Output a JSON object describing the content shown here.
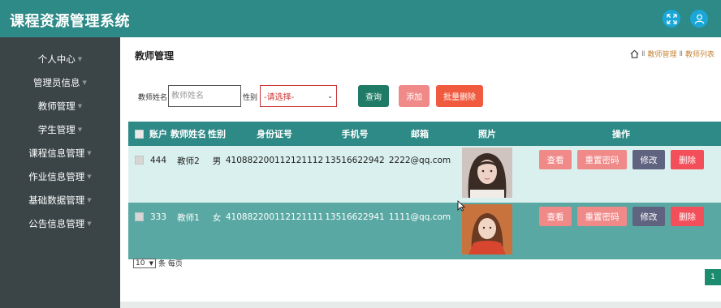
{
  "app": {
    "title": "课程资源管理系统"
  },
  "header": {
    "icons": [
      "fullscreen-icon",
      "user-icon"
    ]
  },
  "sidebar": {
    "items": [
      {
        "label": "个人中心"
      },
      {
        "label": "管理员信息"
      },
      {
        "label": "教师管理"
      },
      {
        "label": "学生管理"
      },
      {
        "label": "课程信息管理"
      },
      {
        "label": "作业信息管理"
      },
      {
        "label": "基础数据管理"
      },
      {
        "label": "公告信息管理"
      }
    ]
  },
  "page": {
    "title": "教师管理",
    "breadcrumb": {
      "sep1": "Ⅱ",
      "level1": "教师管理",
      "sep2": "Ⅱ",
      "level2": "教师列表"
    }
  },
  "search": {
    "name_label": "教师姓名",
    "name_placeholder": "教师姓名",
    "name_value": "",
    "gender_label": "性别",
    "gender_selected": "-请选择-",
    "query_label": "查询",
    "add_label": "添加",
    "batch_delete_label": "批量删除"
  },
  "table": {
    "headers": [
      "账户",
      "教师姓名",
      "性别",
      "身份证号",
      "手机号",
      "邮箱",
      "照片",
      "操作"
    ],
    "rows": [
      {
        "account": "444",
        "name": "教师2",
        "gender": "男",
        "id_card": "410882200112121112",
        "phone": "13516622942",
        "email": "2222@qq.com"
      },
      {
        "account": "333",
        "name": "教师1",
        "gender": "女",
        "id_card": "410882200112121111",
        "phone": "13516622941",
        "email": "1111@qq.com"
      }
    ],
    "actions": {
      "view": "查看",
      "reset_password": "重置密码",
      "edit": "修改",
      "delete": "删除"
    }
  },
  "pagination": {
    "page_size": "10",
    "per_page_label": "条 每页",
    "current_page": "1"
  },
  "colors": {
    "primary": "#2e8a87",
    "sidebar": "#3b4548",
    "row_alt": "#5aa8a3",
    "danger": "#f24f5a",
    "pink": "#f08a89"
  }
}
